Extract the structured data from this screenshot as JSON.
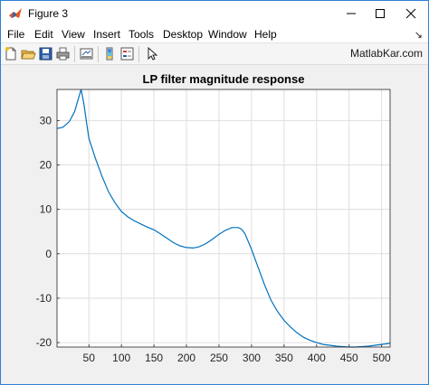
{
  "window": {
    "title": "Figure 3",
    "controls": {
      "minimize": "minimize",
      "maximize": "maximize",
      "close": "close"
    }
  },
  "menu": {
    "items": [
      "File",
      "Edit",
      "View",
      "Insert",
      "Tools",
      "Desktop",
      "Window",
      "Help"
    ]
  },
  "toolbar": {
    "icons": [
      "new-figure-icon",
      "open-file-icon",
      "save-icon",
      "print-icon",
      "link-plot-icon",
      "insert-colorbar-icon",
      "insert-legend-icon",
      "pointer-icon"
    ],
    "watermark": "MatlabKar.com"
  },
  "chart_data": {
    "type": "line",
    "title": "LP filter magnitude response",
    "xlabel": "",
    "ylabel": "",
    "xlim": [
      1,
      513
    ],
    "ylim": [
      -21,
      37
    ],
    "xticks": [
      50,
      100,
      150,
      200,
      250,
      300,
      350,
      400,
      450,
      500
    ],
    "yticks": [
      -20,
      -10,
      0,
      10,
      20,
      30
    ],
    "grid": true,
    "line_color": "#0072bd",
    "series": [
      {
        "x": [
          1,
          10,
          20,
          28,
          34,
          38,
          42,
          46,
          50,
          60,
          70,
          80,
          90,
          100,
          110,
          120,
          130,
          140,
          150,
          160,
          170,
          180,
          190,
          200,
          210,
          220,
          230,
          240,
          250,
          260,
          270,
          280,
          285,
          290,
          300,
          310,
          320,
          330,
          340,
          350,
          360,
          370,
          380,
          390,
          400,
          410,
          420,
          430,
          440,
          450,
          460,
          470,
          480,
          490,
          500,
          510,
          513
        ],
        "y": [
          28.2,
          28.5,
          29.8,
          32.0,
          35.0,
          37.0,
          34.0,
          30.0,
          26.0,
          21.5,
          17.5,
          14.0,
          11.5,
          9.5,
          8.3,
          7.4,
          6.7,
          6.0,
          5.4,
          4.5,
          3.5,
          2.5,
          1.8,
          1.4,
          1.3,
          1.6,
          2.3,
          3.3,
          4.4,
          5.3,
          5.9,
          5.9,
          5.5,
          4.5,
          1.0,
          -3.0,
          -7.0,
          -10.5,
          -13.0,
          -15.0,
          -16.5,
          -17.8,
          -18.8,
          -19.5,
          -20.0,
          -20.4,
          -20.6,
          -20.8,
          -20.9,
          -21.0,
          -21.0,
          -20.9,
          -20.8,
          -20.6,
          -20.4,
          -20.2,
          -20.1
        ]
      }
    ]
  }
}
